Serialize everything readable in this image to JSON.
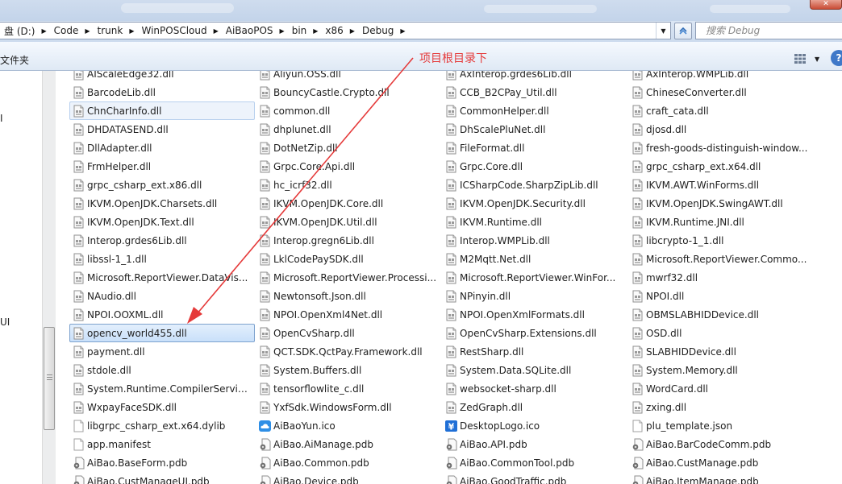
{
  "address": {
    "crumbs": [
      {
        "label": "盘 (D:)"
      },
      {
        "label": "Code"
      },
      {
        "label": "trunk"
      },
      {
        "label": "WinPOSCloud"
      },
      {
        "label": "AiBaoPOS"
      },
      {
        "label": "bin"
      },
      {
        "label": "x86"
      },
      {
        "label": "Debug"
      }
    ],
    "search_placeholder": "搜索 Debug"
  },
  "toolbar": {
    "new_folder_label": "文件夹"
  },
  "nav": {
    "partial_labels": [
      "I",
      "UI"
    ]
  },
  "annotation": {
    "text": "项目根目录下",
    "color": "#e53a3a"
  },
  "files": {
    "columns": [
      {
        "items": [
          {
            "name": "AIScaleEdge32.dll",
            "type": "dll"
          },
          {
            "name": "BarcodeLib.dll",
            "type": "dll"
          },
          {
            "name": "ChnCharInfo.dll",
            "type": "dll",
            "state": "hover"
          },
          {
            "name": "DHDATASEND.dll",
            "type": "dll"
          },
          {
            "name": "DllAdapter.dll",
            "type": "dll"
          },
          {
            "name": "FrmHelper.dll",
            "type": "dll"
          },
          {
            "name": "grpc_csharp_ext.x86.dll",
            "type": "dll"
          },
          {
            "name": "IKVM.OpenJDK.Charsets.dll",
            "type": "dll"
          },
          {
            "name": "IKVM.OpenJDK.Text.dll",
            "type": "dll"
          },
          {
            "name": "Interop.grdes6Lib.dll",
            "type": "dll"
          },
          {
            "name": "libssl-1_1.dll",
            "type": "dll"
          },
          {
            "name": "Microsoft.ReportViewer.DataVis...",
            "type": "dll"
          },
          {
            "name": "NAudio.dll",
            "type": "dll"
          },
          {
            "name": "NPOI.OOXML.dll",
            "type": "dll"
          },
          {
            "name": "opencv_world455.dll",
            "type": "dll",
            "state": "selected"
          },
          {
            "name": "payment.dll",
            "type": "dll"
          },
          {
            "name": "stdole.dll",
            "type": "dll"
          },
          {
            "name": "System.Runtime.CompilerService...",
            "type": "dll"
          },
          {
            "name": "WxpayFaceSDK.dll",
            "type": "dll"
          },
          {
            "name": "libgrpc_csharp_ext.x64.dylib",
            "type": "blank"
          },
          {
            "name": "app.manifest",
            "type": "blank"
          },
          {
            "name": "AiBao.BaseForm.pdb",
            "type": "pdb"
          },
          {
            "name": "AiBao.CustManageUI.pdb",
            "type": "pdb"
          }
        ]
      },
      {
        "items": [
          {
            "name": "Aliyun.OSS.dll",
            "type": "dll"
          },
          {
            "name": "BouncyCastle.Crypto.dll",
            "type": "dll"
          },
          {
            "name": "common.dll",
            "type": "dll"
          },
          {
            "name": "dhplunet.dll",
            "type": "dll"
          },
          {
            "name": "DotNetZip.dll",
            "type": "dll"
          },
          {
            "name": "Grpc.Core.Api.dll",
            "type": "dll"
          },
          {
            "name": "hc_icrf32.dll",
            "type": "dll"
          },
          {
            "name": "IKVM.OpenJDK.Core.dll",
            "type": "dll"
          },
          {
            "name": "IKVM.OpenJDK.Util.dll",
            "type": "dll"
          },
          {
            "name": "Interop.gregn6Lib.dll",
            "type": "dll"
          },
          {
            "name": "LklCodePaySDK.dll",
            "type": "dll"
          },
          {
            "name": "Microsoft.ReportViewer.Processi...",
            "type": "dll"
          },
          {
            "name": "Newtonsoft.Json.dll",
            "type": "dll"
          },
          {
            "name": "NPOI.OpenXml4Net.dll",
            "type": "dll"
          },
          {
            "name": "OpenCvSharp.dll",
            "type": "dll"
          },
          {
            "name": "QCT.SDK.QctPay.Framework.dll",
            "type": "dll"
          },
          {
            "name": "System.Buffers.dll",
            "type": "dll"
          },
          {
            "name": "tensorflowlite_c.dll",
            "type": "dll"
          },
          {
            "name": "YxfSdk.WindowsForm.dll",
            "type": "dll"
          },
          {
            "name": "AiBaoYun.ico",
            "type": "cloud"
          },
          {
            "name": "AiBao.AiManage.pdb",
            "type": "pdb"
          },
          {
            "name": "AiBao.Common.pdb",
            "type": "pdb"
          },
          {
            "name": "AiBao.Device.pdb",
            "type": "pdb"
          }
        ]
      },
      {
        "items": [
          {
            "name": "AxInterop.grdes6Lib.dll",
            "type": "dll"
          },
          {
            "name": "CCB_B2CPay_Util.dll",
            "type": "dll"
          },
          {
            "name": "CommonHelper.dll",
            "type": "dll"
          },
          {
            "name": "DhScalePluNet.dll",
            "type": "dll"
          },
          {
            "name": "FileFormat.dll",
            "type": "dll"
          },
          {
            "name": "Grpc.Core.dll",
            "type": "dll"
          },
          {
            "name": "ICSharpCode.SharpZipLib.dll",
            "type": "dll"
          },
          {
            "name": "IKVM.OpenJDK.Security.dll",
            "type": "dll"
          },
          {
            "name": "IKVM.Runtime.dll",
            "type": "dll"
          },
          {
            "name": "Interop.WMPLib.dll",
            "type": "dll"
          },
          {
            "name": "M2Mqtt.Net.dll",
            "type": "dll"
          },
          {
            "name": "Microsoft.ReportViewer.WinFor...",
            "type": "dll"
          },
          {
            "name": "NPinyin.dll",
            "type": "dll"
          },
          {
            "name": "NPOI.OpenXmlFormats.dll",
            "type": "dll"
          },
          {
            "name": "OpenCvSharp.Extensions.dll",
            "type": "dll"
          },
          {
            "name": "RestSharp.dll",
            "type": "dll"
          },
          {
            "name": "System.Data.SQLite.dll",
            "type": "dll"
          },
          {
            "name": "websocket-sharp.dll",
            "type": "dll"
          },
          {
            "name": "ZedGraph.dll",
            "type": "dll"
          },
          {
            "name": "DesktopLogo.ico",
            "type": "yen"
          },
          {
            "name": "AiBao.API.pdb",
            "type": "pdb"
          },
          {
            "name": "AiBao.CommonTool.pdb",
            "type": "pdb"
          },
          {
            "name": "AiBao.GoodTraffic.pdb",
            "type": "pdb"
          }
        ]
      },
      {
        "items": [
          {
            "name": "AxInterop.WMPLib.dll",
            "type": "dll"
          },
          {
            "name": "ChineseConverter.dll",
            "type": "dll"
          },
          {
            "name": "craft_cata.dll",
            "type": "dll"
          },
          {
            "name": "djosd.dll",
            "type": "dll"
          },
          {
            "name": "fresh-goods-distinguish-window...",
            "type": "dll"
          },
          {
            "name": "grpc_csharp_ext.x64.dll",
            "type": "dll"
          },
          {
            "name": "IKVM.AWT.WinForms.dll",
            "type": "dll"
          },
          {
            "name": "IKVM.OpenJDK.SwingAWT.dll",
            "type": "dll"
          },
          {
            "name": "IKVM.Runtime.JNI.dll",
            "type": "dll"
          },
          {
            "name": "libcrypto-1_1.dll",
            "type": "dll"
          },
          {
            "name": "Microsoft.ReportViewer.Commo...",
            "type": "dll"
          },
          {
            "name": "mwrf32.dll",
            "type": "dll"
          },
          {
            "name": "NPOI.dll",
            "type": "dll"
          },
          {
            "name": "OBMSLABHIDDevice.dll",
            "type": "dll"
          },
          {
            "name": "OSD.dll",
            "type": "dll"
          },
          {
            "name": "SLABHIDDevice.dll",
            "type": "dll"
          },
          {
            "name": "System.Memory.dll",
            "type": "dll"
          },
          {
            "name": "WordCard.dll",
            "type": "dll"
          },
          {
            "name": "zxing.dll",
            "type": "dll"
          },
          {
            "name": "plu_template.json",
            "type": "blank"
          },
          {
            "name": "AiBao.BarCodeComm.pdb",
            "type": "pdb"
          },
          {
            "name": "AiBao.CustManage.pdb",
            "type": "pdb"
          },
          {
            "name": "AiBao.ItemManage.pdb",
            "type": "pdb"
          }
        ]
      }
    ]
  }
}
